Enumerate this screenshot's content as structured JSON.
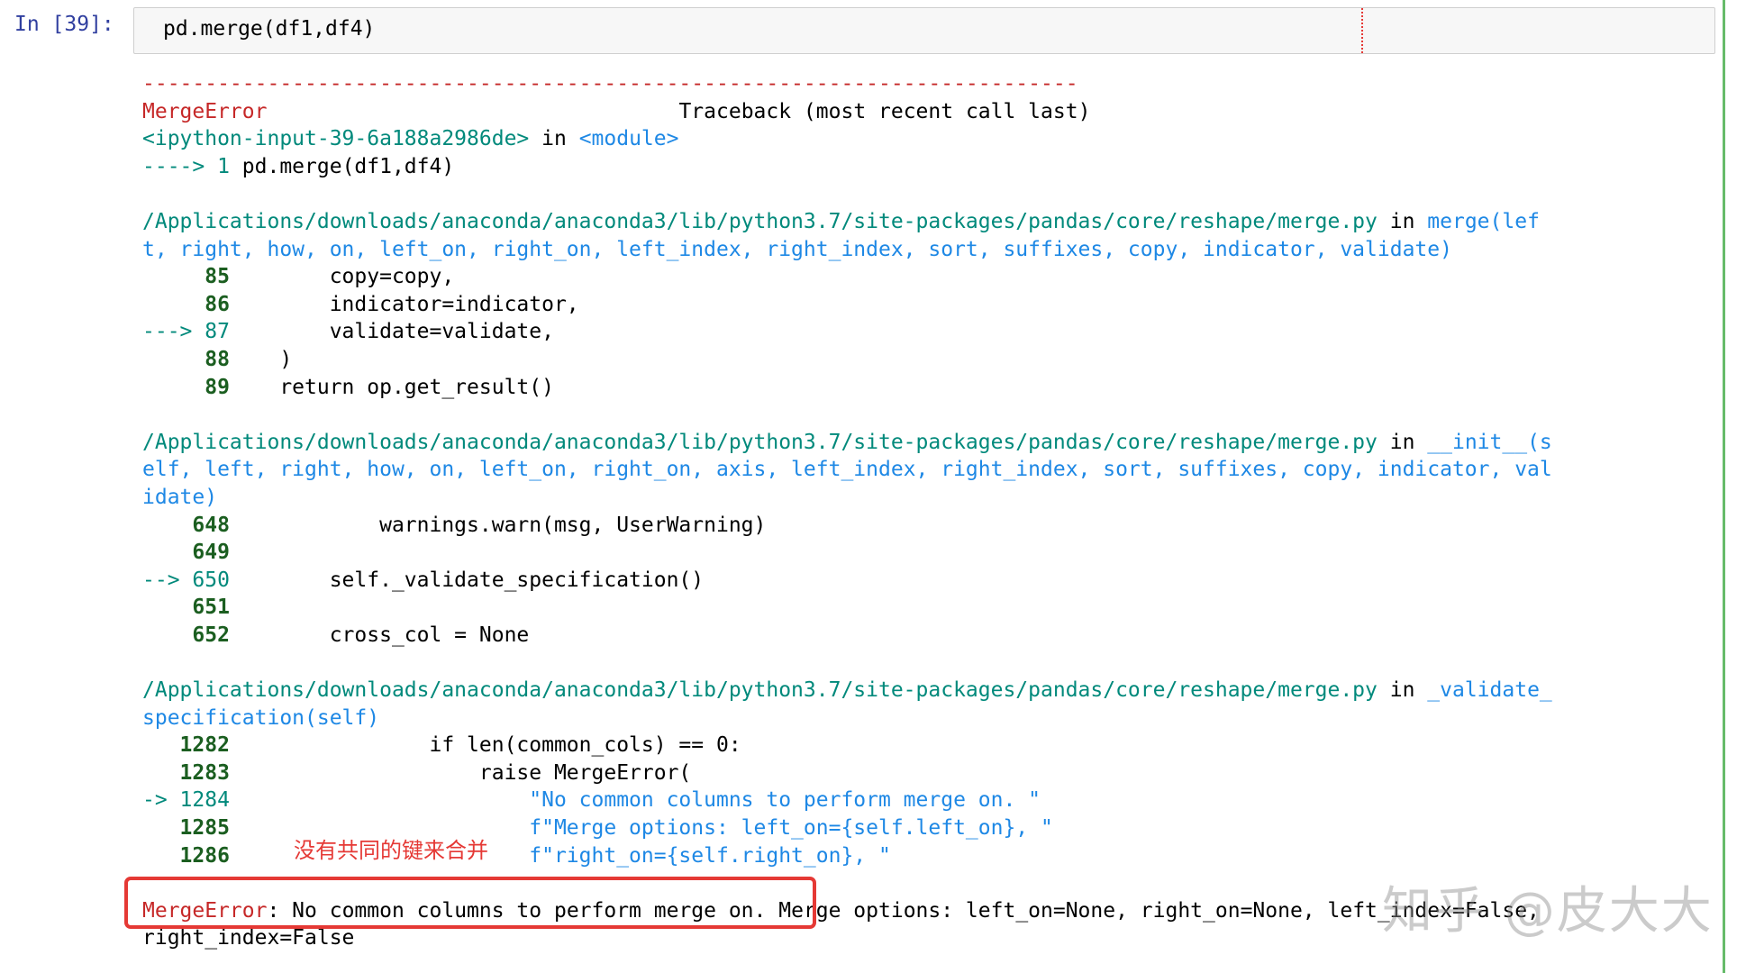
{
  "cell": {
    "prompt": "In [39]:",
    "input_code": "pd.merge(df1,df4)"
  },
  "traceback": {
    "separator": "---------------------------------------------------------------------------",
    "error_name": "MergeError",
    "traceback_label": "Traceback (most recent call last)",
    "input_ref": "<ipython-input-39-6a188a2986de>",
    "in_word": "in",
    "module": "<module>",
    "call_arrow": "----> 1",
    "call_code": "pd.merge(df1,df4)",
    "frames": [
      {
        "path": "/Applications/downloads/anaconda/anaconda3/lib/python3.7/site-packages/pandas/core/reshape/merge.py",
        "in_word": "in",
        "func_wrap": [
          "merge(lef",
          "t, right, how, on, left_on, right_on, left_index, right_index, sort, suffixes, copy, indicator, validate)"
        ],
        "lines": [
          {
            "prefix": "     85",
            "code": "        copy=copy,"
          },
          {
            "prefix": "     86",
            "code": "        indicator=indicator,"
          },
          {
            "prefix": "---> 87",
            "code": "        validate=validate,"
          },
          {
            "prefix": "     88",
            "code": "    )"
          },
          {
            "prefix": "     89",
            "code": "    return op.get_result()"
          }
        ]
      },
      {
        "path": "/Applications/downloads/anaconda/anaconda3/lib/python3.7/site-packages/pandas/core/reshape/merge.py",
        "in_word": "in",
        "func_wrap": [
          "__init__(s",
          "elf, left, right, how, on, left_on, right_on, axis, left_index, right_index, sort, suffixes, copy, indicator, val",
          "idate)"
        ],
        "lines": [
          {
            "prefix": "    648",
            "code": "            warnings.warn(msg, UserWarning)"
          },
          {
            "prefix": "    649",
            "code": ""
          },
          {
            "prefix": "--> 650",
            "code": "        self._validate_specification()"
          },
          {
            "prefix": "    651",
            "code": ""
          },
          {
            "prefix": "    652",
            "code": "        cross_col = None"
          }
        ]
      },
      {
        "path": "/Applications/downloads/anaconda/anaconda3/lib/python3.7/site-packages/pandas/core/reshape/merge.py",
        "in_word": "in",
        "func_wrap": [
          "_validate_",
          "specification(self)"
        ],
        "lines": [
          {
            "prefix": "   1282",
            "code": "                if len(common_cols) == 0:"
          },
          {
            "prefix": "   1283",
            "code": "                    raise MergeError("
          },
          {
            "prefix": "-> 1284",
            "code": "                        \"No common columns to perform merge on. \""
          },
          {
            "prefix": "   1285",
            "code": "                        f\"Merge options: left_on={self.left_on}, \""
          },
          {
            "prefix": "   1286",
            "code": "                        f\"right_on={self.right_on}, \""
          }
        ]
      }
    ],
    "final_error_name": "MergeError",
    "final_message_1": ": No common columns to perform merge on. Merge options: left_on=None, right_on=None, left_index=False,",
    "final_message_2": "right_index=False"
  },
  "annotation": {
    "note": "没有共同的键来合并",
    "watermark": "知乎 @皮大大"
  },
  "colors": {
    "error_red": "#c62828",
    "path_green": "#00897b",
    "lineno_green": "#1b5e20",
    "punct_blue": "#1e88e5",
    "highlight_box": "#e53935",
    "cell_rail": "#66bb6a"
  }
}
